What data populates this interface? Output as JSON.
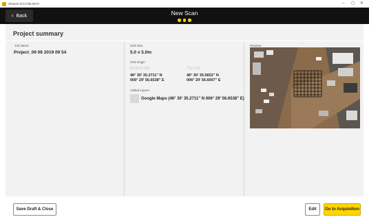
{
  "window": {
    "title": "Shaerer EC1706.0673",
    "minimize": "–",
    "maximize": "▢",
    "close": "✕"
  },
  "header": {
    "back_label": "Back",
    "back_icon": "chevron-left-icon",
    "title": "New Scan",
    "steps": 3
  },
  "summary": {
    "title": "Project summary",
    "job_name_label": "Job Name",
    "job_name": "Project_09 08 2019 09 54",
    "grid_size_label": "Grid Size",
    "grid_size": "5.0 x 5.0m",
    "grid_origin_label": "Grid Origin",
    "bottom_left_label": "Bottom left",
    "bottom_left_lat": "46° 30' 35.2711\" N",
    "bottom_left_lon": "006° 29' 56.6538\" E",
    "top_left_label": "Top left",
    "top_left_lat": "46° 30' 35.5652\" N",
    "top_left_lon": "006° 29' 56.6007\" E",
    "added_layers_label": "Added Layers",
    "layer_name": "Google Maps (46° 30' 35.2711\" N 006° 29' 56.6538\" E)",
    "preview_label": "Preview"
  },
  "footer": {
    "save_label": "Save Draft & Close",
    "edit_label": "Edit",
    "go_label": "Go to Acquisition"
  },
  "colors": {
    "accent": "#ffd500",
    "header_bg": "#111111",
    "panel_bg": "#f2f2f2"
  }
}
